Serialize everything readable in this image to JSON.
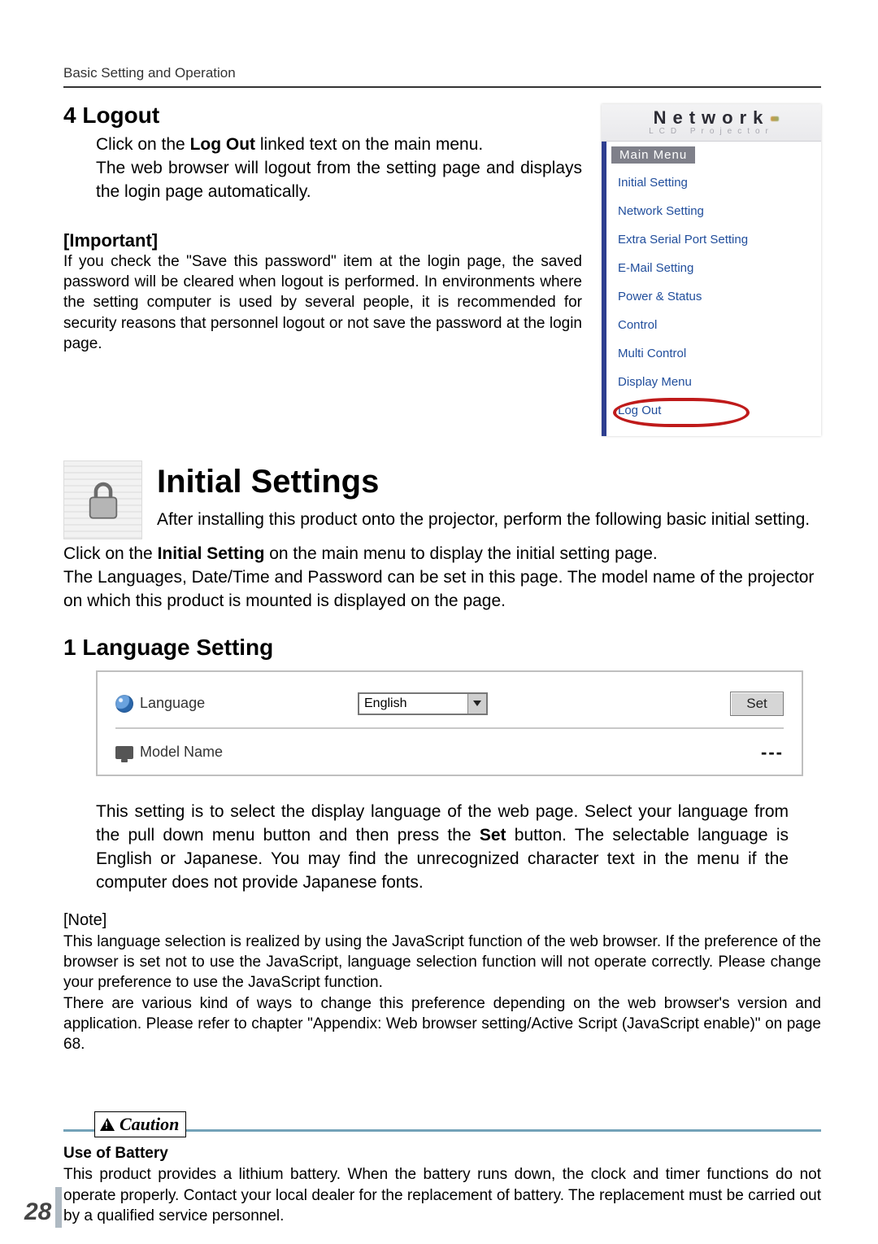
{
  "running_head": "Basic Setting and Operation",
  "sec_logout": {
    "heading": "4 Logout",
    "p1_a": "Click on the ",
    "p1_link": "Log Out",
    "p1_b": " linked text on the main menu.",
    "p2": "The web browser will logout from the setting page and displays the login page automatically.",
    "important_head": "[Important]",
    "important_body": "If you check the \"Save this password\" item at the login page, the saved password will be cleared when logout is performed. In environments where the setting computer is used by several people, it is recommended for security reasons that personnel logout or not save the password at the login page."
  },
  "menu_fig": {
    "product_title": "Network",
    "product_sub": "LCD Projector",
    "main_menu_label": "Main Menu",
    "items": [
      "Initial Setting",
      "Network Setting",
      "Extra Serial Port Setting",
      "E-Mail Setting",
      "Power & Status",
      "Control",
      "Multi Control",
      "Display Menu",
      "Log Out"
    ]
  },
  "sec_initial": {
    "title": "Initial Settings",
    "intro": "After installing this product onto the projector, perform the following basic initial setting.",
    "line2_a": "Click on the ",
    "line2_bold": "Initial Setting",
    "line2_b": " on the main menu to display the initial setting page.",
    "line3": "The Languages, Date/Time and Password can be set in this page. The model name of the projector on which this product is mounted is displayed on the page."
  },
  "sec_lang": {
    "heading": "1 Language Setting",
    "label_language": "Language",
    "selected_language": "English",
    "set_button": "Set",
    "label_model": "Model Name",
    "model_value": "---",
    "desc_a": "This setting is to select the display language of the web page. Select your language from the pull down menu button and then press the ",
    "desc_bold": "Set",
    "desc_b": " button. The selectable language is English or Japanese. You may find the unrecognized character text in the menu if the computer does not provide Japanese fonts.",
    "note_head": "[Note]",
    "note1": "This language selection is realized by using the JavaScript function of the web browser. If the preference of the browser is set not to use the JavaScript, language selection function will not operate correctly. Please change your preference to use the JavaScript function.",
    "note2": "There are various kind of ways to change this preference depending on the web browser's version and application. Please refer to chapter \"Appendix: Web browser setting/Active Script (JavaScript enable)\" on page 68."
  },
  "caution": {
    "label": "Caution",
    "h": "Use of Battery",
    "body": "This product provides a lithium battery. When the battery runs down, the clock and timer functions do not operate properly. Contact your local dealer for the replacement of battery. The replacement must be carried out by a qualified service personnel."
  },
  "page_number": "28"
}
